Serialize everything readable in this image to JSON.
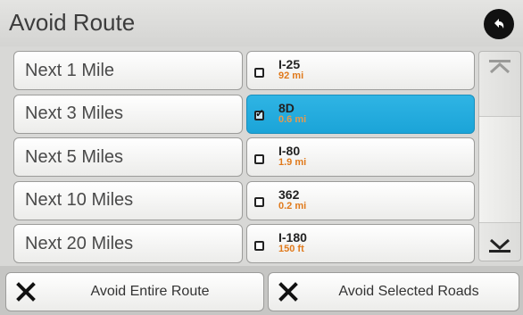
{
  "header": {
    "title": "Avoid Route",
    "back_icon": "back-arrow-icon"
  },
  "distances": [
    {
      "label": "Next 1 Mile"
    },
    {
      "label": "Next 3 Miles"
    },
    {
      "label": "Next 5 Miles"
    },
    {
      "label": "Next 10 Miles"
    },
    {
      "label": "Next 20 Miles"
    }
  ],
  "roads": [
    {
      "name": "I-25",
      "distance": "92 mi",
      "checked": false
    },
    {
      "name": "8D",
      "distance": "0.6 mi",
      "checked": true
    },
    {
      "name": "I-80",
      "distance": "1.9 mi",
      "checked": false
    },
    {
      "name": "362",
      "distance": "0.2 mi",
      "checked": false
    },
    {
      "name": "I-180",
      "distance": "150 ft",
      "checked": false
    }
  ],
  "actions": {
    "avoid_entire_route": "Avoid Entire Route",
    "avoid_selected_roads": "Avoid Selected Roads"
  },
  "colors": {
    "selected": "#1ba4d8",
    "distance_text": "#e07a1c"
  }
}
